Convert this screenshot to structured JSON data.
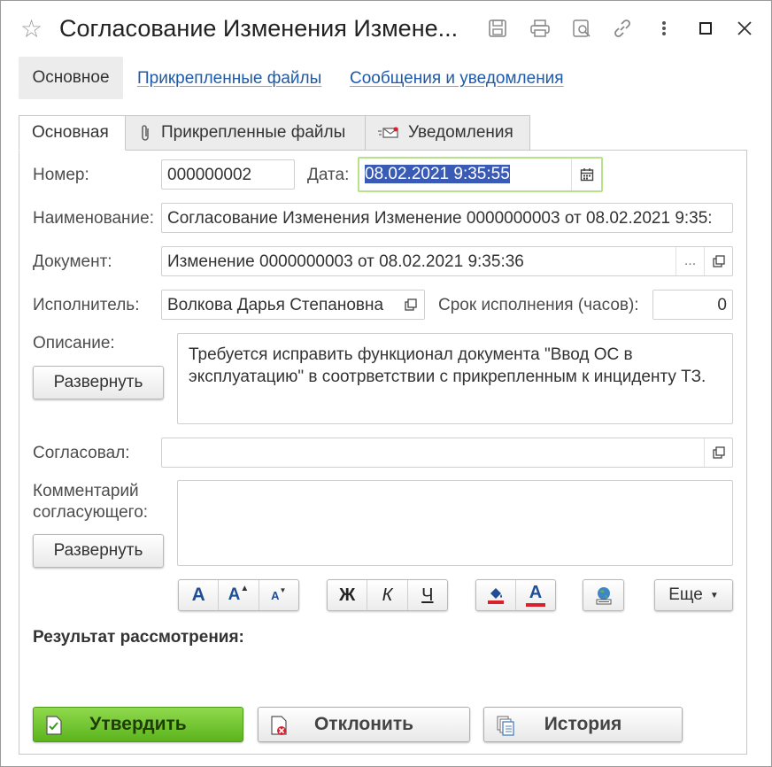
{
  "window": {
    "title": "Согласование Изменения Измене...",
    "icons": [
      "star-icon",
      "save-icon",
      "print-icon",
      "preview-icon",
      "link-icon",
      "more-vertical-icon",
      "maximize-icon",
      "close-icon"
    ]
  },
  "nav": {
    "main": "Основное",
    "links": [
      "Прикрепленные файлы",
      "Сообщения и уведомления"
    ]
  },
  "tabs": {
    "main": "Основная",
    "files": "Прикрепленные файлы",
    "notifications": "Уведомления"
  },
  "form": {
    "number_label": "Номер:",
    "number_value": "000000002",
    "date_label": "Дата:",
    "date_value": "08.02.2021  9:35:55",
    "name_label": "Наименование:",
    "name_value": "Согласование Изменения Изменение 0000000003 от 08.02.2021 9:35:",
    "document_label": "Документ:",
    "document_value": "Изменение 0000000003 от 08.02.2021 9:35:36",
    "document_select": "...",
    "executor_label": "Исполнитель:",
    "executor_value": "Волкова Дарья Степановна",
    "deadline_label": "Срок исполнения (часов):",
    "deadline_value": "0",
    "description_label": "Описание:",
    "description_value": "Требуется исправить функционал документа \"Ввод ОС в эксплуатацию\" в соотрветствии с прикрепленным к инциденту ТЗ.",
    "expand_label": "Развернуть",
    "approved_label": "Согласовал:",
    "approved_value": "",
    "comment_label_1": "Комментарий",
    "comment_label_2": "согласующего:",
    "comment_value": "",
    "expand2_label": "Развернуть"
  },
  "format_toolbar": {
    "font_size": "A",
    "increase": "A",
    "decrease": "A",
    "bold": "Ж",
    "italic": "К",
    "underline": "Ч",
    "fill_color": "fill-color-icon",
    "text_color": "A",
    "insert_image": "image-icon",
    "more": "Еще",
    "accent_red": "#d9202b",
    "accent_blue": "#1f4e96"
  },
  "result_label": "Результат рассмотрения:",
  "actions": {
    "approve": "Утвердить",
    "reject": "Отклонить",
    "history": "История",
    "approve_color": "#6cc52c"
  }
}
